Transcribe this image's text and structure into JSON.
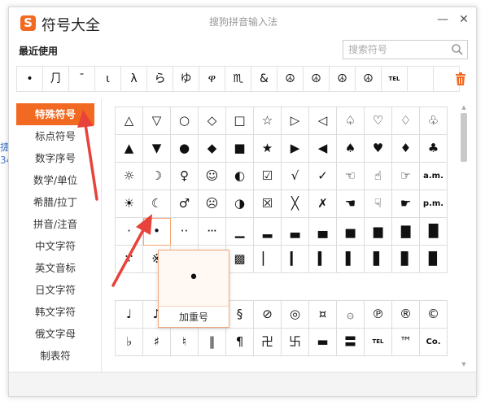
{
  "window": {
    "title": "符号大全",
    "ime_name": "搜狗拼音输入法",
    "logo_letter": "S",
    "minimize_glyph": "—",
    "close_glyph": "✕"
  },
  "edge_fragments": [
    "捷",
    "34"
  ],
  "recent": {
    "label": "最近使用",
    "symbols": [
      "•",
      "⺆",
      "¯",
      "ι",
      "λ",
      "ら",
      "ゆ",
      "ዋ",
      "♏",
      "&",
      "☮",
      "☮",
      "☮",
      "☮",
      "TEL",
      "",
      ""
    ]
  },
  "search": {
    "placeholder": "搜索符号"
  },
  "sidebar": {
    "items": [
      "特殊符号",
      "标点符号",
      "数字序号",
      "数学/单位",
      "希腊/拉丁",
      "拼音/注音",
      "中文字符",
      "英文音标",
      "日文字符",
      "韩文字符",
      "俄文字母",
      "制表符"
    ],
    "active_index": 0
  },
  "grid_top": [
    [
      "△",
      "▽",
      "○",
      "◇",
      "□",
      "☆",
      "▷",
      "◁",
      "♤",
      "♡",
      "♢",
      "♧"
    ],
    [
      "▲",
      "▼",
      "●",
      "◆",
      "■",
      "★",
      "▶",
      "◀",
      "♠",
      "♥",
      "♦",
      "♣"
    ],
    [
      "☼",
      "☽",
      "♀",
      "☺",
      "◐",
      "☑",
      "√",
      "✓",
      "☜",
      "☝",
      "☞",
      "a.m."
    ],
    [
      "☀",
      "☾",
      "♂",
      "☹",
      "◑",
      "☒",
      "╳",
      "✗",
      "☚",
      "☟",
      "☛",
      "p.m."
    ],
    [
      "·",
      "•",
      "··",
      "···",
      "▁",
      "▂",
      "▃",
      "▄",
      "▅",
      "▆",
      "▇",
      "█"
    ],
    [
      "∵",
      "※",
      "",
      "",
      "▩",
      "▏",
      "▎",
      "▍",
      "▌",
      "▋",
      "▊",
      "▉"
    ]
  ],
  "grid_bottom": [
    [
      "♩",
      "♪",
      "",
      "",
      "§",
      "⊘",
      "◎",
      "¤",
      "۞",
      "℗",
      "®",
      "©"
    ],
    [
      "♭",
      "♯",
      "♮",
      "‖",
      "¶",
      "卍",
      "卐",
      "▬",
      "〓",
      "TEL",
      "™",
      "Co."
    ]
  ],
  "preview": {
    "symbol": "•",
    "name": "加重号"
  },
  "colors": {
    "accent": "#f26a21",
    "arrow": "#e8433a"
  }
}
